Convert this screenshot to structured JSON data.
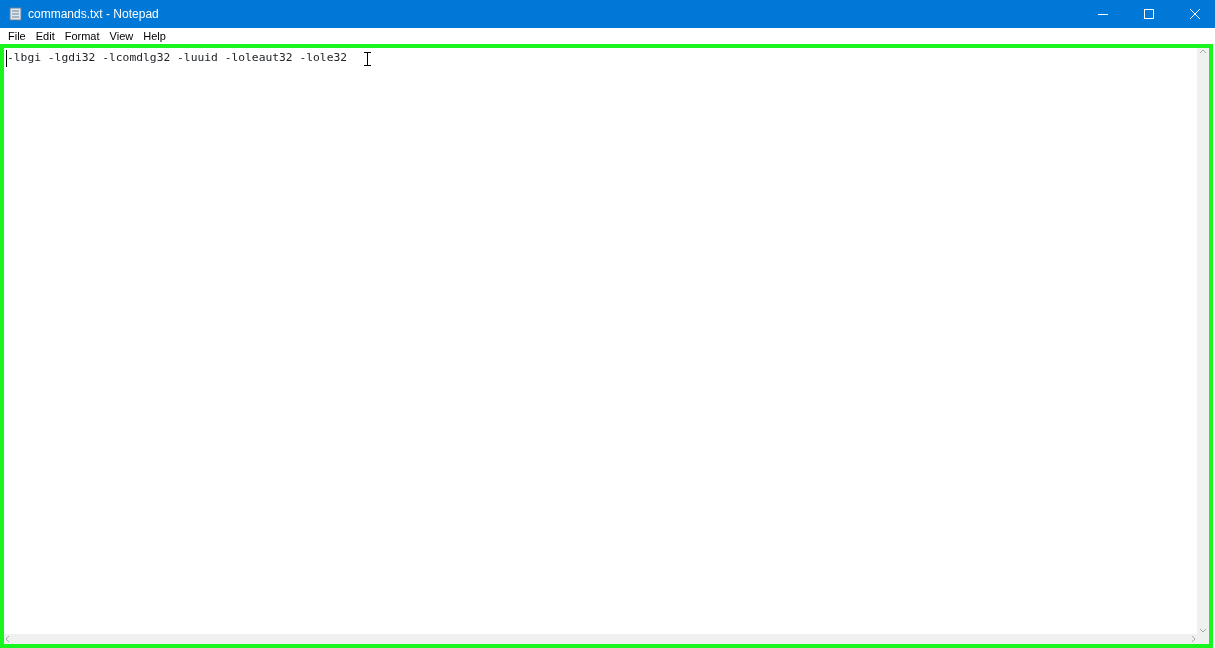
{
  "window": {
    "title": "commands.txt - Notepad"
  },
  "menu": [
    "File",
    "Edit",
    "Format",
    "View",
    "Help"
  ],
  "editor": {
    "text": "-lbgi -lgdi32 -lcomdlg32 -luuid -loleaut32 -lole32",
    "highlighted": true
  }
}
